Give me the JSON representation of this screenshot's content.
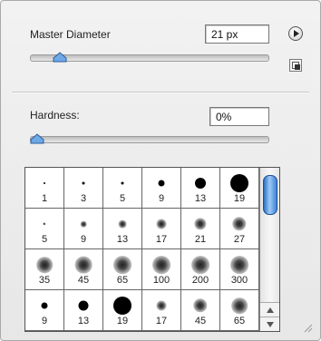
{
  "master_diameter": {
    "label": "Master Diameter",
    "value": "21 px",
    "slider_fraction": 0.1
  },
  "hardness": {
    "label": "Hardness:",
    "value": "0%",
    "slider_fraction": 0.0
  },
  "icons": {
    "menu": "flyout-menu-icon",
    "new_preset": "new-brush-preset-icon",
    "resize": "resize-grip-icon"
  },
  "brushes": [
    {
      "label": "1",
      "size": 2,
      "soft": false
    },
    {
      "label": "3",
      "size": 3,
      "soft": false
    },
    {
      "label": "5",
      "size": 3,
      "soft": false
    },
    {
      "label": "9",
      "size": 7,
      "soft": false
    },
    {
      "label": "13",
      "size": 12,
      "soft": false
    },
    {
      "label": "19",
      "size": 20,
      "soft": false
    },
    {
      "label": "5",
      "size": 3,
      "soft": true
    },
    {
      "label": "9",
      "size": 6,
      "soft": true
    },
    {
      "label": "13",
      "size": 8,
      "soft": true
    },
    {
      "label": "17",
      "size": 10,
      "soft": true
    },
    {
      "label": "21",
      "size": 12,
      "soft": true
    },
    {
      "label": "27",
      "size": 14,
      "soft": true
    },
    {
      "label": "35",
      "size": 16,
      "soft": true
    },
    {
      "label": "45",
      "size": 17,
      "soft": true
    },
    {
      "label": "65",
      "size": 18,
      "soft": true
    },
    {
      "label": "100",
      "size": 18,
      "soft": true
    },
    {
      "label": "200",
      "size": 18,
      "soft": true
    },
    {
      "label": "300",
      "size": 18,
      "soft": true
    },
    {
      "label": "9",
      "size": 7,
      "soft": false
    },
    {
      "label": "13",
      "size": 11,
      "soft": false
    },
    {
      "label": "19",
      "size": 20,
      "soft": false
    },
    {
      "label": "17",
      "size": 10,
      "soft": true
    },
    {
      "label": "45",
      "size": 14,
      "soft": true
    },
    {
      "label": "65",
      "size": 16,
      "soft": true
    }
  ]
}
